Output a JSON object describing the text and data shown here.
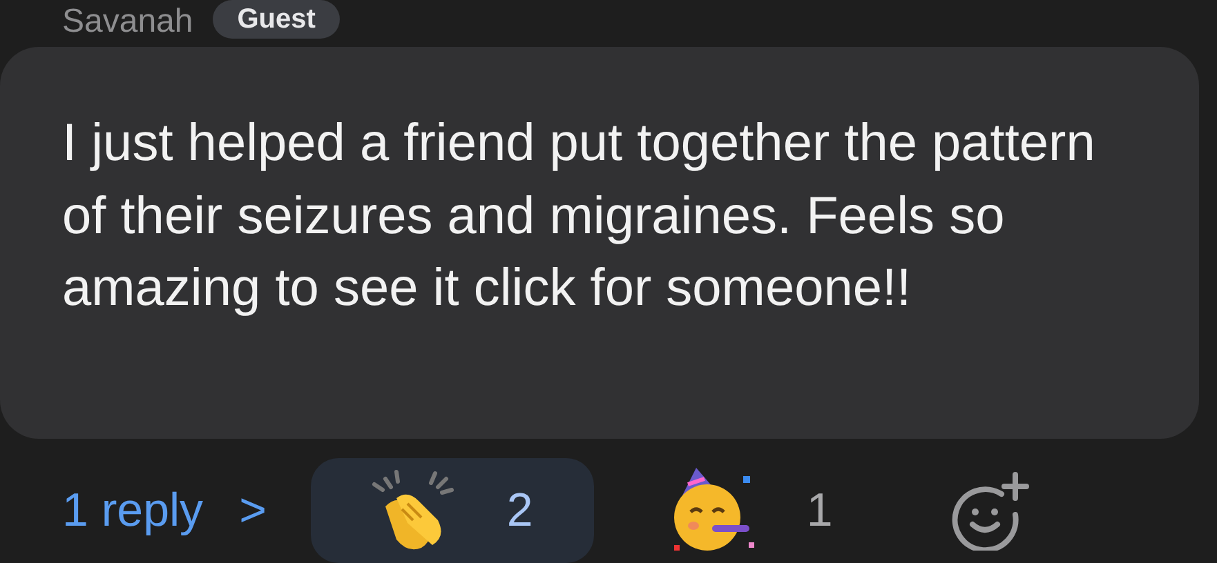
{
  "author": {
    "name": "Savanah",
    "badge": "Guest"
  },
  "message": {
    "text": "I just helped a friend put together the pattern of their seizures and migraines. Feels so amazing to see it click for someone!!"
  },
  "replies": {
    "label": "1 reply",
    "chevron": ">"
  },
  "reactions": [
    {
      "kind": "clap",
      "count": "2",
      "selected": true
    },
    {
      "kind": "party",
      "count": "1",
      "selected": false
    }
  ]
}
